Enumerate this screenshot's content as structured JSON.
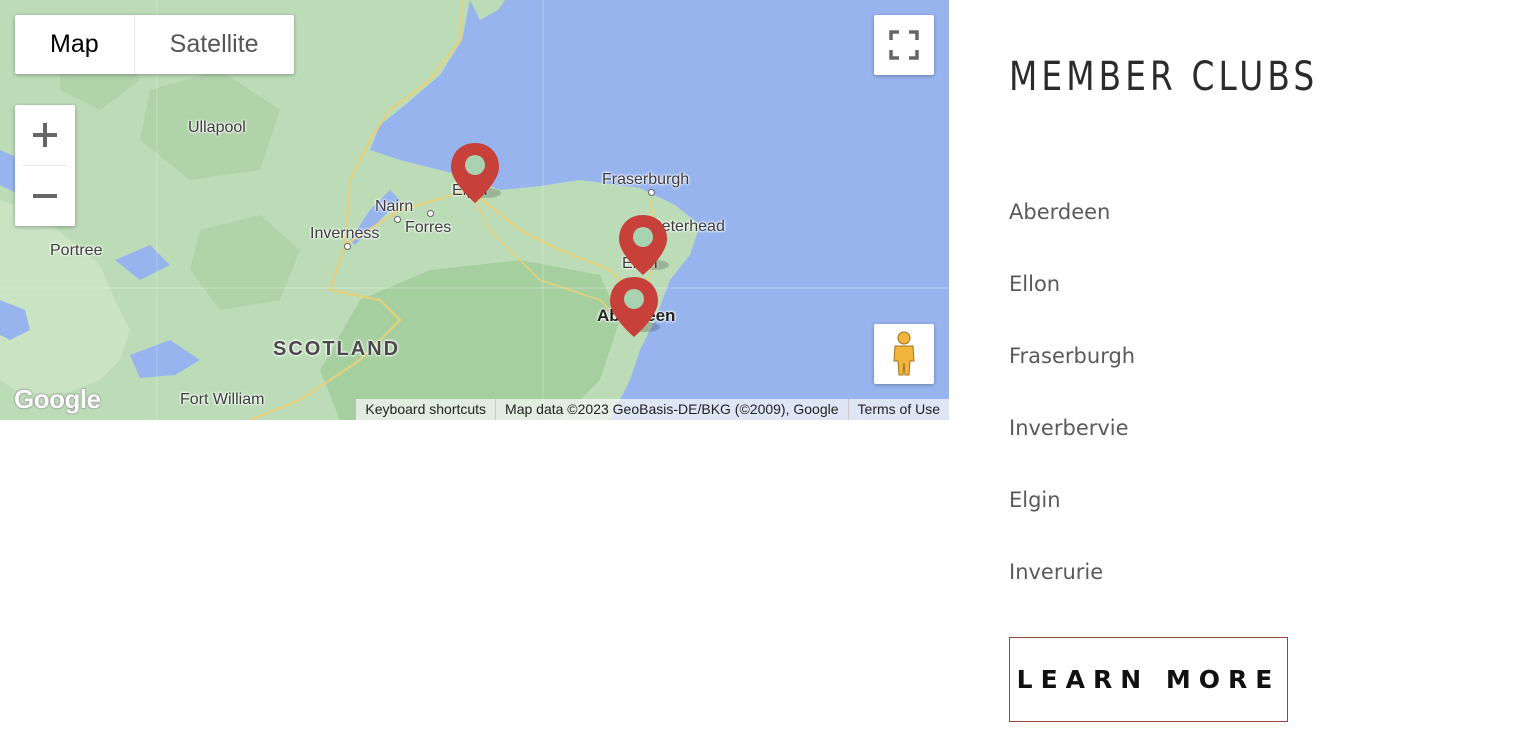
{
  "map": {
    "type_control": {
      "map_label": "Map",
      "satellite_label": "Satellite"
    },
    "labels": {
      "ullapool": "Ullapool",
      "nairn": "Nairn",
      "forres": "Forres",
      "inverness": "Inverness",
      "portree": "Portree",
      "scotland": "SCOTLAND",
      "fort_william": "Fort William",
      "fraserburgh": "Fraserburgh",
      "peterhead": "Peterhead",
      "aberdeen": "Aberdeen",
      "elgin": "Elgin",
      "ellon": "Ellon"
    },
    "logo": "Google",
    "attribution": {
      "shortcuts": "Keyboard shortcuts",
      "data": "Map data ©2023 GeoBasis-DE/BKG (©2009), Google",
      "terms": "Terms of Use"
    },
    "colors": {
      "water": "#98b4ef",
      "land": "#bcdcb8",
      "marker": "#c7403a"
    },
    "icons": {
      "fullscreen": "fullscreen-icon",
      "pegman": "pegman-icon",
      "zoom_in": "plus-icon",
      "zoom_out": "minus-icon",
      "marker": "map-pin-icon"
    }
  },
  "sidebar": {
    "title": "MEMBER CLUBS",
    "clubs": [
      "Aberdeen",
      "Ellon",
      "Fraserburgh",
      "Inverbervie",
      "Elgin",
      "Inverurie"
    ],
    "button_label": "LEARN MORE"
  }
}
